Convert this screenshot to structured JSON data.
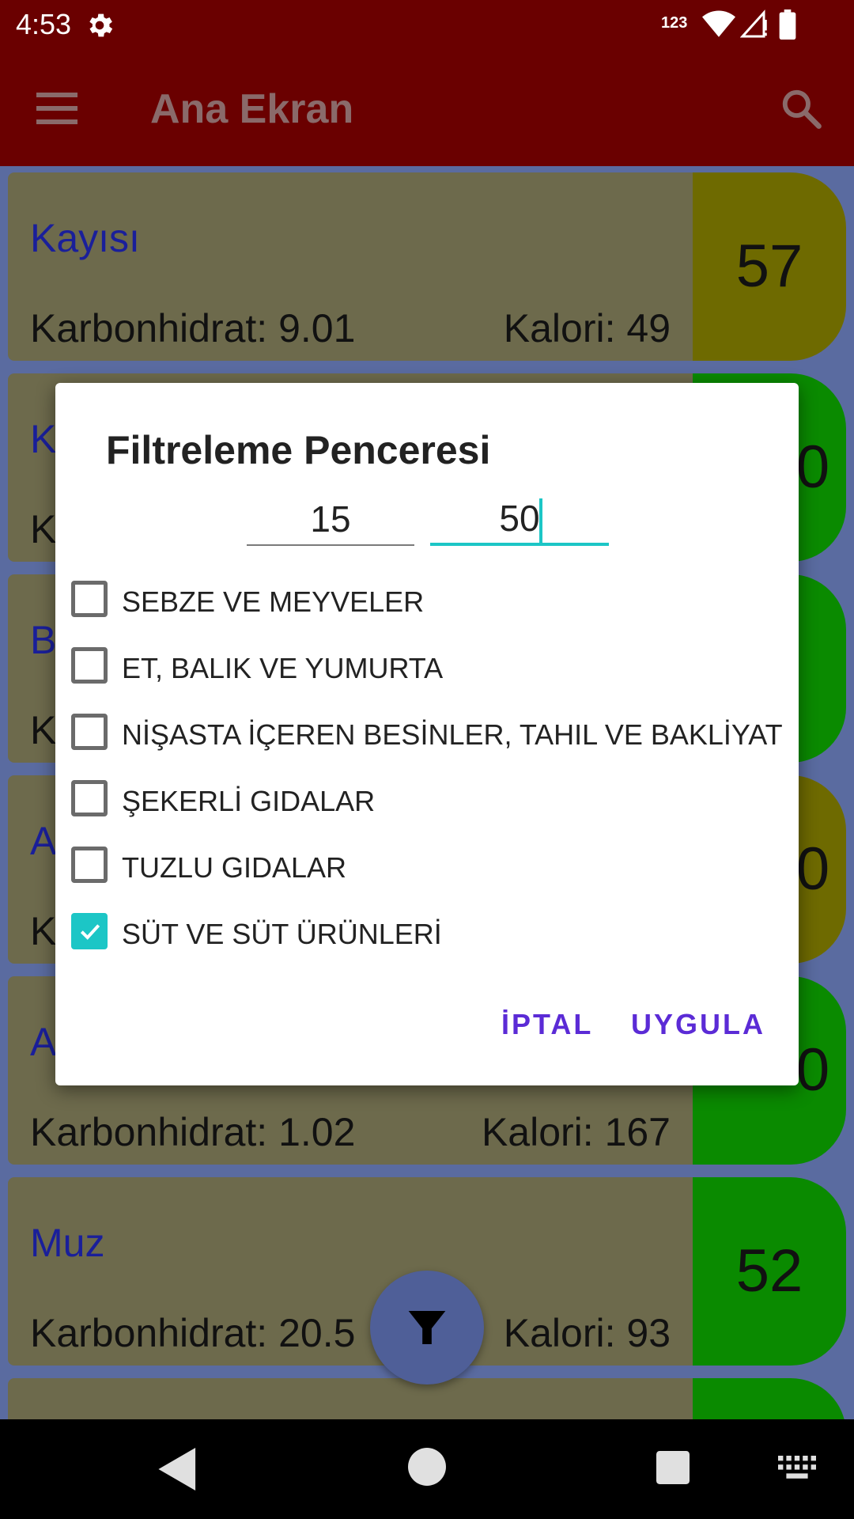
{
  "status_bar": {
    "time": "4:53",
    "indicator": "123",
    "icons": [
      "gear-icon",
      "wifi-icon",
      "signal-icon",
      "battery-icon"
    ]
  },
  "app_bar": {
    "title": "Ana Ekran",
    "icons": [
      "menu-icon",
      "search-icon"
    ],
    "background": "#6a0000"
  },
  "list": {
    "items": [
      {
        "name": "Kayısı",
        "carb": "Karbonhidrat: 9.01",
        "kalori": "Kalori: 49",
        "gi": "57",
        "color": "#6e6a00"
      },
      {
        "name": "K",
        "carb": "K",
        "kalori": "",
        "gi": "0",
        "color": "#0a8a00"
      },
      {
        "name": "B",
        "carb": "K",
        "kalori": "",
        "gi": "",
        "color": "#0a8a00"
      },
      {
        "name": "A",
        "carb": "K",
        "kalori": "",
        "gi": "0",
        "color": "#6e6a00"
      },
      {
        "name": "A",
        "carb": "Karbonhidrat: 1.02",
        "kalori": "Kalori: 167",
        "gi": "0",
        "color": "#0a8a00"
      },
      {
        "name": "Muz",
        "carb": "Karbonhidrat: 20.5",
        "kalori": "Kalori: 93",
        "gi": "52",
        "color": "#0a8a00"
      },
      {
        "name": "",
        "carb": "",
        "kalori": "",
        "gi": "",
        "color": "#0a8a00"
      }
    ]
  },
  "dialog": {
    "title": "Filtreleme Penceresi",
    "range_min": "15",
    "range_max": "50",
    "categories": [
      {
        "label": "SEBZE VE MEYVELER",
        "checked": false
      },
      {
        "label": "ET, BALIK VE YUMURTA",
        "checked": false
      },
      {
        "label": "NİŞASTA İÇEREN BESİNLER, TAHIL VE BAKLİYAT",
        "checked": false
      },
      {
        "label": "ŞEKERLİ GIDALAR",
        "checked": false
      },
      {
        "label": "TUZLU GIDALAR",
        "checked": false
      },
      {
        "label": "SÜT VE SÜT ÜRÜNLERİ",
        "checked": true
      }
    ],
    "cancel_label": "İPTAL",
    "apply_label": "UYGULA",
    "accent": "#1cc6c6",
    "button_color": "#5b2bd6"
  },
  "fab": {
    "icon": "filter-icon"
  },
  "nav_bar": {
    "icons": [
      "back-icon",
      "home-icon",
      "recents-icon",
      "keyboard-icon"
    ]
  }
}
